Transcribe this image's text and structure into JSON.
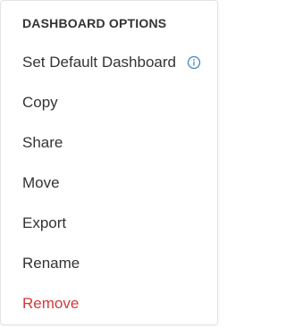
{
  "menu": {
    "header": "DASHBOARD OPTIONS",
    "items": [
      {
        "label": "Set Default Dashboard",
        "icon": "info-icon"
      },
      {
        "label": "Copy"
      },
      {
        "label": "Share"
      },
      {
        "label": "Move"
      },
      {
        "label": "Export"
      },
      {
        "label": "Rename"
      },
      {
        "label": "Remove"
      }
    ]
  },
  "colors": {
    "text": "#333333",
    "danger": "#d13a3a",
    "info": "#3f86c6",
    "border": "#e3e3e3"
  }
}
